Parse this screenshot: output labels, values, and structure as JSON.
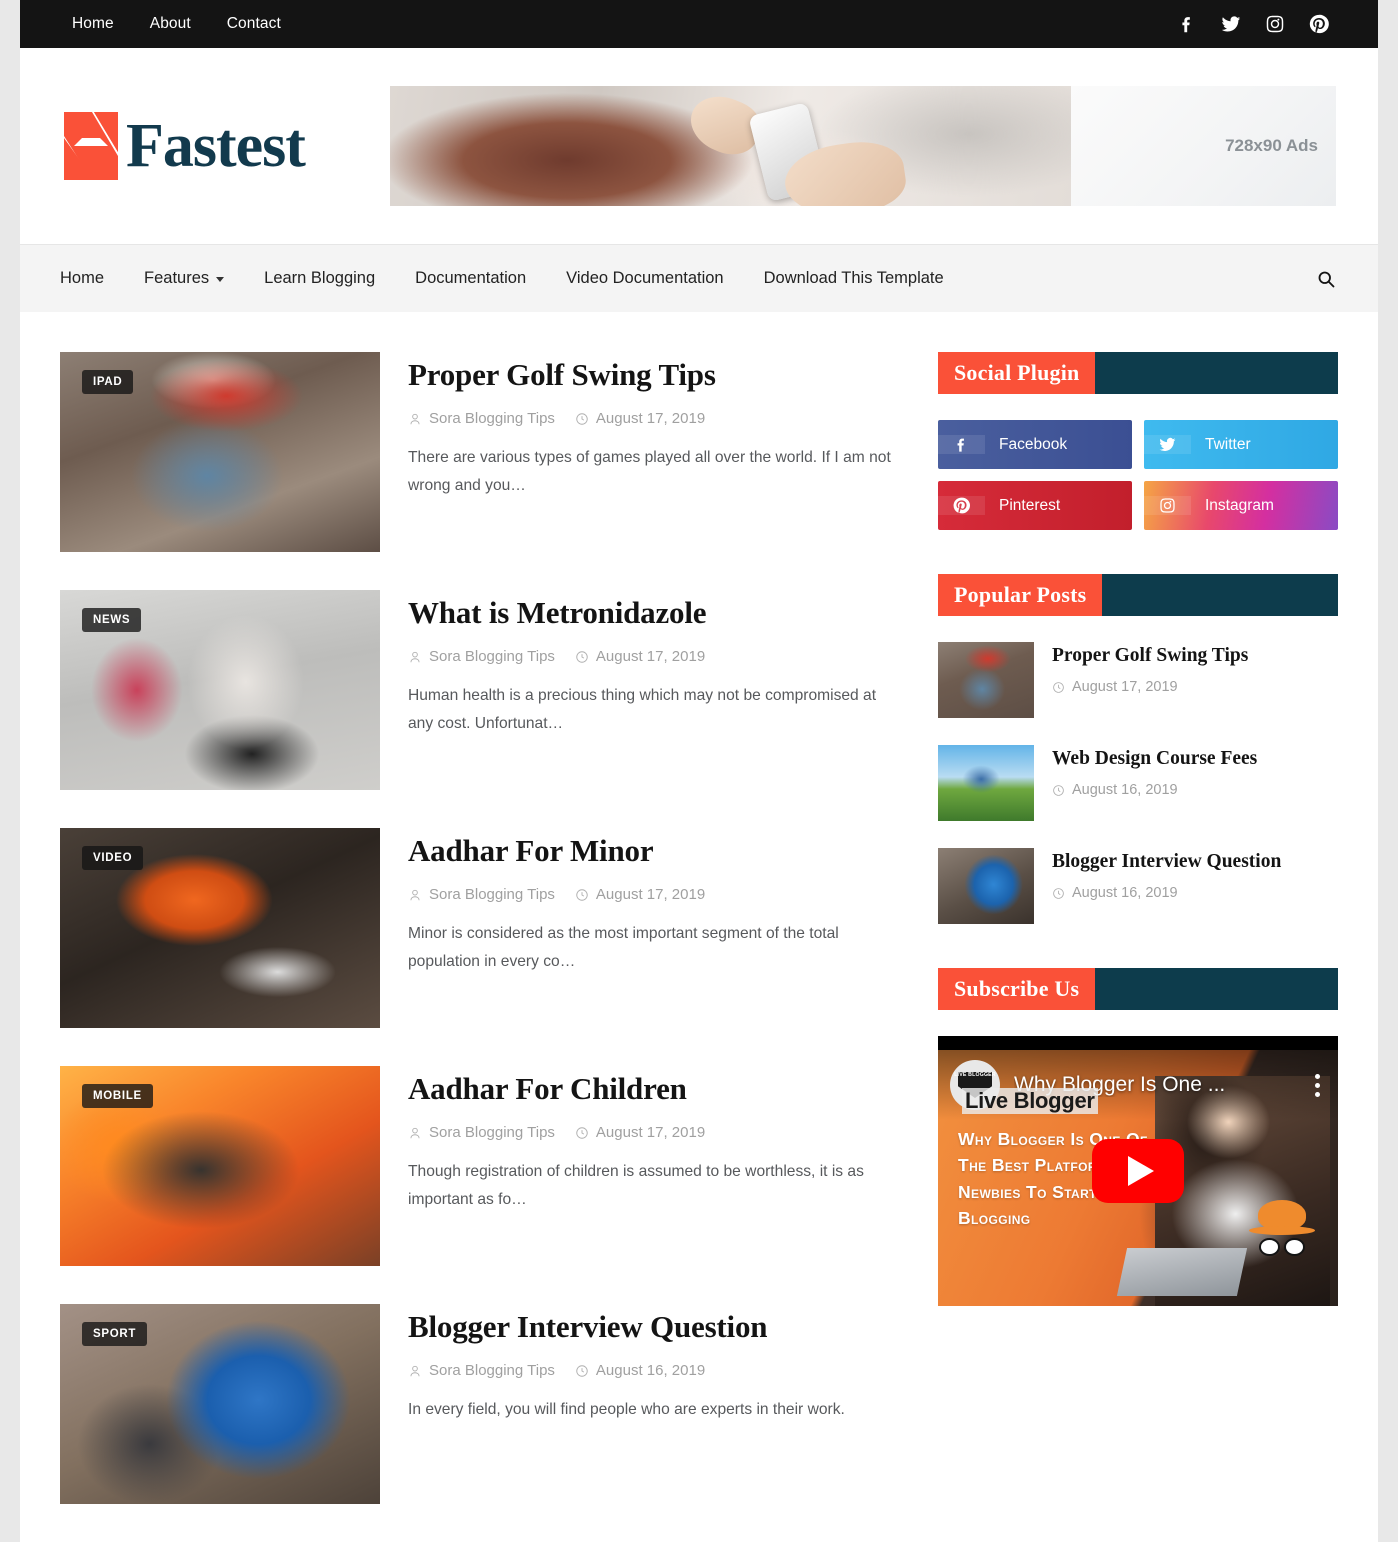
{
  "topbar": {
    "links": [
      "Home",
      "About",
      "Contact"
    ],
    "social": [
      "facebook-icon",
      "twitter-icon",
      "instagram-icon",
      "pinterest-icon"
    ]
  },
  "header": {
    "logo_text": "Fastest",
    "ad_label": "728x90 Ads"
  },
  "mainnav": {
    "items": [
      {
        "label": "Home",
        "has_caret": false
      },
      {
        "label": "Features",
        "has_caret": true
      },
      {
        "label": "Learn Blogging",
        "has_caret": false
      },
      {
        "label": "Documentation",
        "has_caret": false
      },
      {
        "label": "Video Documentation",
        "has_caret": false
      },
      {
        "label": "Download This Template",
        "has_caret": false
      }
    ],
    "search_icon": "search-icon"
  },
  "posts": [
    {
      "badge": "IPAD",
      "title": "Proper Golf Swing Tips",
      "author": "Sora Blogging Tips",
      "date": "August 17, 2019",
      "snippet": "There are various types of games played all over the world. If I am not wrong and you…"
    },
    {
      "badge": "NEWS",
      "title": "What is Metronidazole",
      "author": "Sora Blogging Tips",
      "date": "August 17, 2019",
      "snippet": "Human health is a precious thing which may not be compromised at any cost. Unfortunat…"
    },
    {
      "badge": "VIDEO",
      "title": "Aadhar For Minor",
      "author": "Sora Blogging Tips",
      "date": "August 17, 2019",
      "snippet": "Minor is considered as the most important segment of the total population in every co…"
    },
    {
      "badge": "MOBILE",
      "title": "Aadhar For Children",
      "author": "Sora Blogging Tips",
      "date": "August 17, 2019",
      "snippet": "Though registration of children is assumed to be worthless, it is as important as fo…"
    },
    {
      "badge": "SPORT",
      "title": "Blogger Interview Question",
      "author": "Sora Blogging Tips",
      "date": "August 16, 2019",
      "snippet": "In every field, you will find people who are experts in their work."
    }
  ],
  "sidebar": {
    "social_widget": {
      "title": "Social Plugin",
      "buttons": [
        {
          "label": "Facebook",
          "icon": "facebook-icon",
          "color": "#3b4f93"
        },
        {
          "label": "Twitter",
          "icon": "twitter-icon",
          "color": "#2fa8e4"
        },
        {
          "label": "Pinterest",
          "icon": "pinterest-icon",
          "color": "#c21f2c"
        },
        {
          "label": "Instagram",
          "icon": "instagram-icon",
          "color": "#d42fa0"
        }
      ]
    },
    "popular_widget": {
      "title": "Popular Posts",
      "items": [
        {
          "title": "Proper Golf Swing Tips",
          "date": "August 17, 2019"
        },
        {
          "title": "Web Design Course Fees",
          "date": "August 16, 2019"
        },
        {
          "title": "Blogger Interview Question",
          "date": "August 16, 2019"
        }
      ]
    },
    "subscribe_widget": {
      "title": "Subscribe Us",
      "video_title": "Why Blogger Is One ...",
      "channel": "Live Blogger",
      "thumbnail_text": "Why Blogger Is One Of The Best Platform For Newbies To Start Blogging"
    }
  },
  "theme": {
    "accent": "#fa5138",
    "dark_teal": "#0d3c4c",
    "topbar_bg": "#141414",
    "logo_navy": "#123a4d"
  }
}
